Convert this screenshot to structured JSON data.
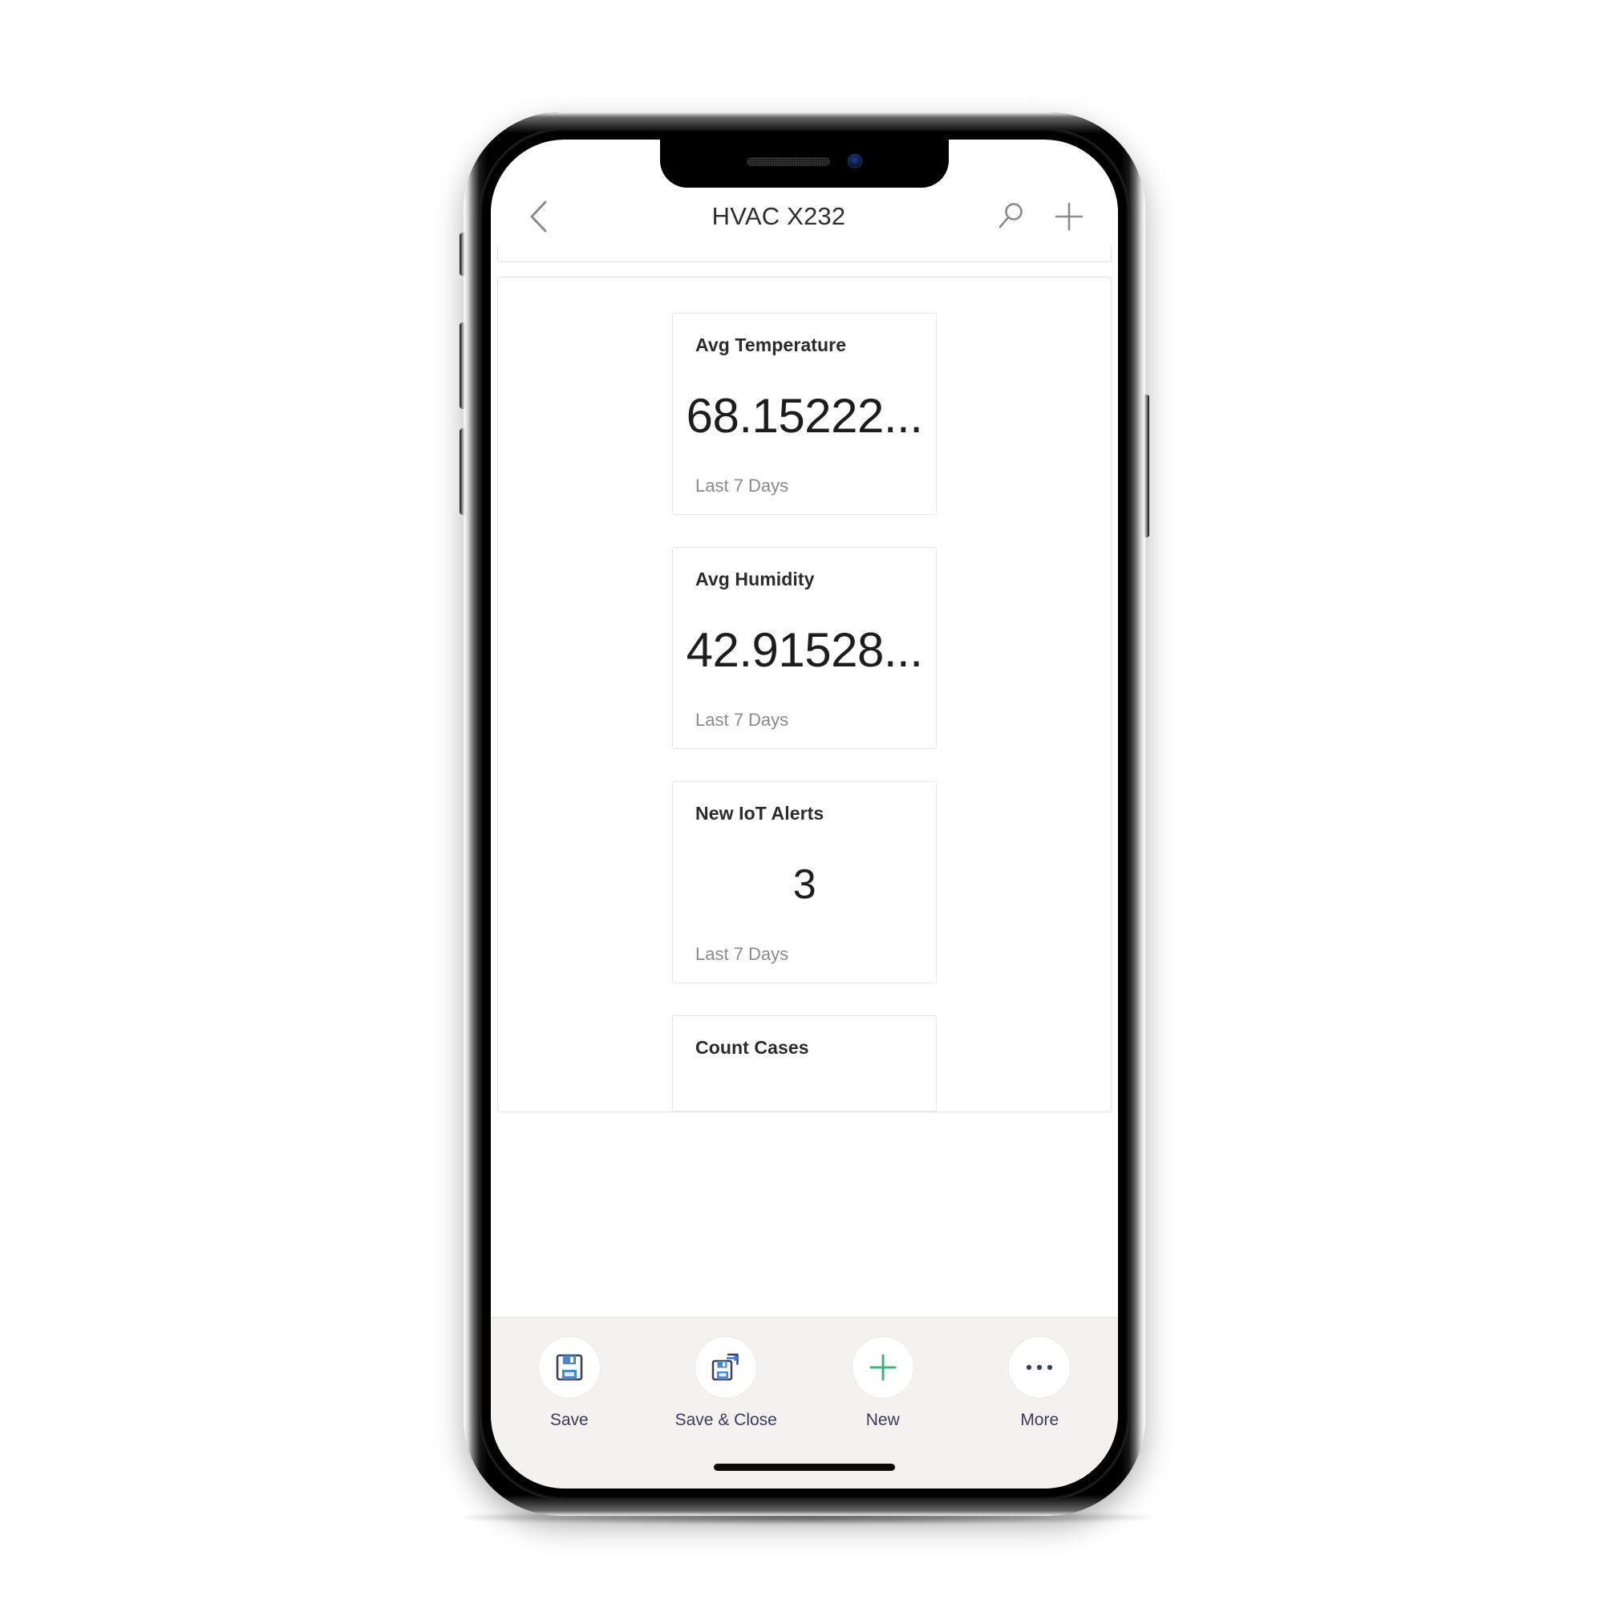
{
  "app": {
    "header": {
      "back_icon": "chevron-left-icon",
      "title": "HVAC X232",
      "search_icon": "search-icon",
      "new_icon": "plus-icon"
    },
    "cards": [
      {
        "title": "Avg Temperature",
        "value": "68.15222...",
        "footer": "Last 7 Days",
        "partial": false
      },
      {
        "title": "Avg Humidity",
        "value": "42.91528...",
        "footer": "Last 7 Days",
        "partial": false
      },
      {
        "title": "New IoT Alerts",
        "value": "3",
        "footer": "Last 7 Days",
        "partial": false
      },
      {
        "title": "Count Cases",
        "value": "",
        "footer": "",
        "partial": true
      }
    ],
    "command_bar": {
      "items": [
        {
          "label": "Save",
          "icon": "save-floppy-icon"
        },
        {
          "label": "Save & Close",
          "icon": "save-and-close-icon"
        },
        {
          "label": "New",
          "icon": "plus-icon"
        },
        {
          "label": "More",
          "icon": "ellipsis-icon"
        }
      ]
    }
  },
  "colors": {
    "accent_blue": "#3b6fb6",
    "accent_green": "#45b07c",
    "label_text": "#3b3a5a",
    "card_border": "#e6e6e6",
    "command_bar_bg": "#f3f2f1"
  }
}
